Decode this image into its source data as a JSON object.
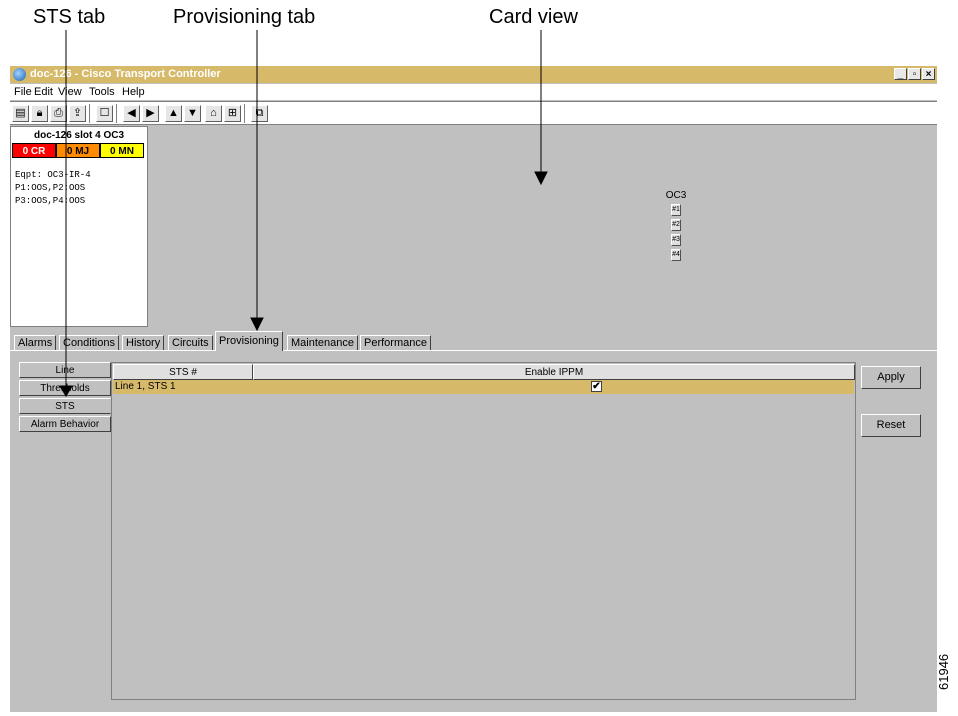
{
  "callouts": {
    "sts_tab": "STS tab",
    "provisioning_tab": "Provisioning tab",
    "card_view": "Card view"
  },
  "window": {
    "title": "doc-126 - Cisco Transport Controller",
    "min": "_",
    "max": "▫",
    "close": "×"
  },
  "menu": {
    "file": "File",
    "edit": "Edit",
    "view": "View",
    "tools": "Tools",
    "help": "Help"
  },
  "summary": {
    "node_title": "doc-126 slot 4 OC3",
    "critical": "0 CR",
    "major": "0 MJ",
    "minor": "0 MN",
    "eqpt": "Eqpt: OC3-IR-4",
    "ports_1": "P1:OOS,P2:OOS",
    "ports_2": "P3:OOS,P4:OOS"
  },
  "card": {
    "label": "OC3",
    "ports": [
      "#1",
      "#2",
      "#3",
      "#4"
    ]
  },
  "tabs": {
    "alarms": "Alarms",
    "conditions": "Conditions",
    "history": "History",
    "circuits": "Circuits",
    "provisioning": "Provisioning",
    "maintenance": "Maintenance",
    "performance": "Performance"
  },
  "subtabs": {
    "line": "Line",
    "thresholds": "Thresholds",
    "sts": "STS",
    "alarm_behavior": "Alarm Behavior"
  },
  "table": {
    "headers": {
      "sts": "STS #",
      "enable_ippm": "Enable IPPM"
    },
    "rows": [
      {
        "sts": "Line 1, STS 1",
        "enable_ippm": true,
        "check_glyph": "✔"
      }
    ]
  },
  "buttons": {
    "apply": "Apply",
    "reset": "Reset"
  },
  "figure_id": "61946",
  "colors": {
    "titlebar": "#d7b96a",
    "selected_row": "#d7b96a",
    "critical": "#ff0000",
    "major": "#ff8c00",
    "minor": "#ffff00",
    "panel": "#c0c0c0"
  }
}
